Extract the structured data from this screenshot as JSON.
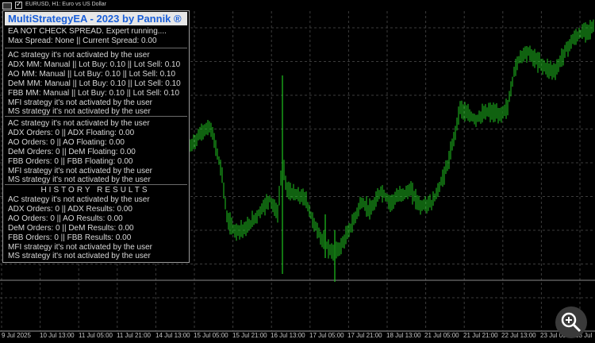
{
  "window": {
    "title": "EURUSD, H1:  Euro vs US Dollar"
  },
  "panel": {
    "header": "MultiStrategyEA - 2023 by Pannik ®",
    "status_lines": [
      "EA NOT CHECK SPREAD.  Expert running....",
      "Max Spread: None || Current Spread: 0.00"
    ],
    "mm_lines": [
      "AC strategy it's not activated by the user",
      "ADX MM: Manual || Lot Buy: 0.10 || Lot Sell: 0.10",
      "AO MM: Manual || Lot Buy: 0.10 || Lot Sell: 0.10",
      "DeM MM: Manual || Lot Buy: 0.10 || Lot Sell: 0.10",
      "FBB MM: Manual || Lot Buy: 0.10 || Lot Sell: 0.10",
      "MFI strategy it's not activated by the user",
      "MS strategy it's not activated by the user"
    ],
    "order_lines": [
      "AC strategy it's not activated by the user",
      "ADX Orders: 0 || ADX Floating: 0.00",
      "AO Orders: 0 || AO Floating: 0.00",
      "DeM Orders: 0 || DeM Floating: 0.00",
      "FBB Orders: 0 || FBB Floating: 0.00",
      "MFI strategy it's not activated by the user",
      "MS strategy it's not activated by the user"
    ],
    "history_title": "HISTORY RESULTS",
    "history_lines": [
      "AC strategy it's not activated by the user",
      "ADX Orders: 0 || ADX Results: 0.00",
      "AO Orders: 0 || AO Results: 0.00",
      "DeM Orders: 0 || DeM Results: 0.00",
      "FBB Orders: 0 || FBB Results: 0.00",
      "MFI strategy it's not activated by the user",
      "MS strategy it's not activated by the user"
    ]
  },
  "xaxis": {
    "labels": [
      "9 Jul 2025",
      "10 Jul 13:00",
      "11 Jul 05:00",
      "11 Jul 21:00",
      "14 Jul 13:00",
      "15 Jul 05:00",
      "15 Jul 21:00",
      "16 Jul 13:00",
      "17 Jul 05:00",
      "17 Jul 21:00",
      "18 Jul 13:00",
      "21 Jul 05:00",
      "21 Jul 21:00",
      "22 Jul 13:00",
      "23 Jul 05:00",
      "23 Jul"
    ]
  },
  "colors": {
    "background": "#000000",
    "candles": "#1fc41f",
    "grid": "#3c3c3c",
    "panel_header_text": "#1a5fd8",
    "panel_text": "#d8d8d8"
  },
  "icons": {
    "zoom": "magnifier-zoom-icon",
    "chart": "chart-icon",
    "checkbox": "checkbox-icon"
  }
}
